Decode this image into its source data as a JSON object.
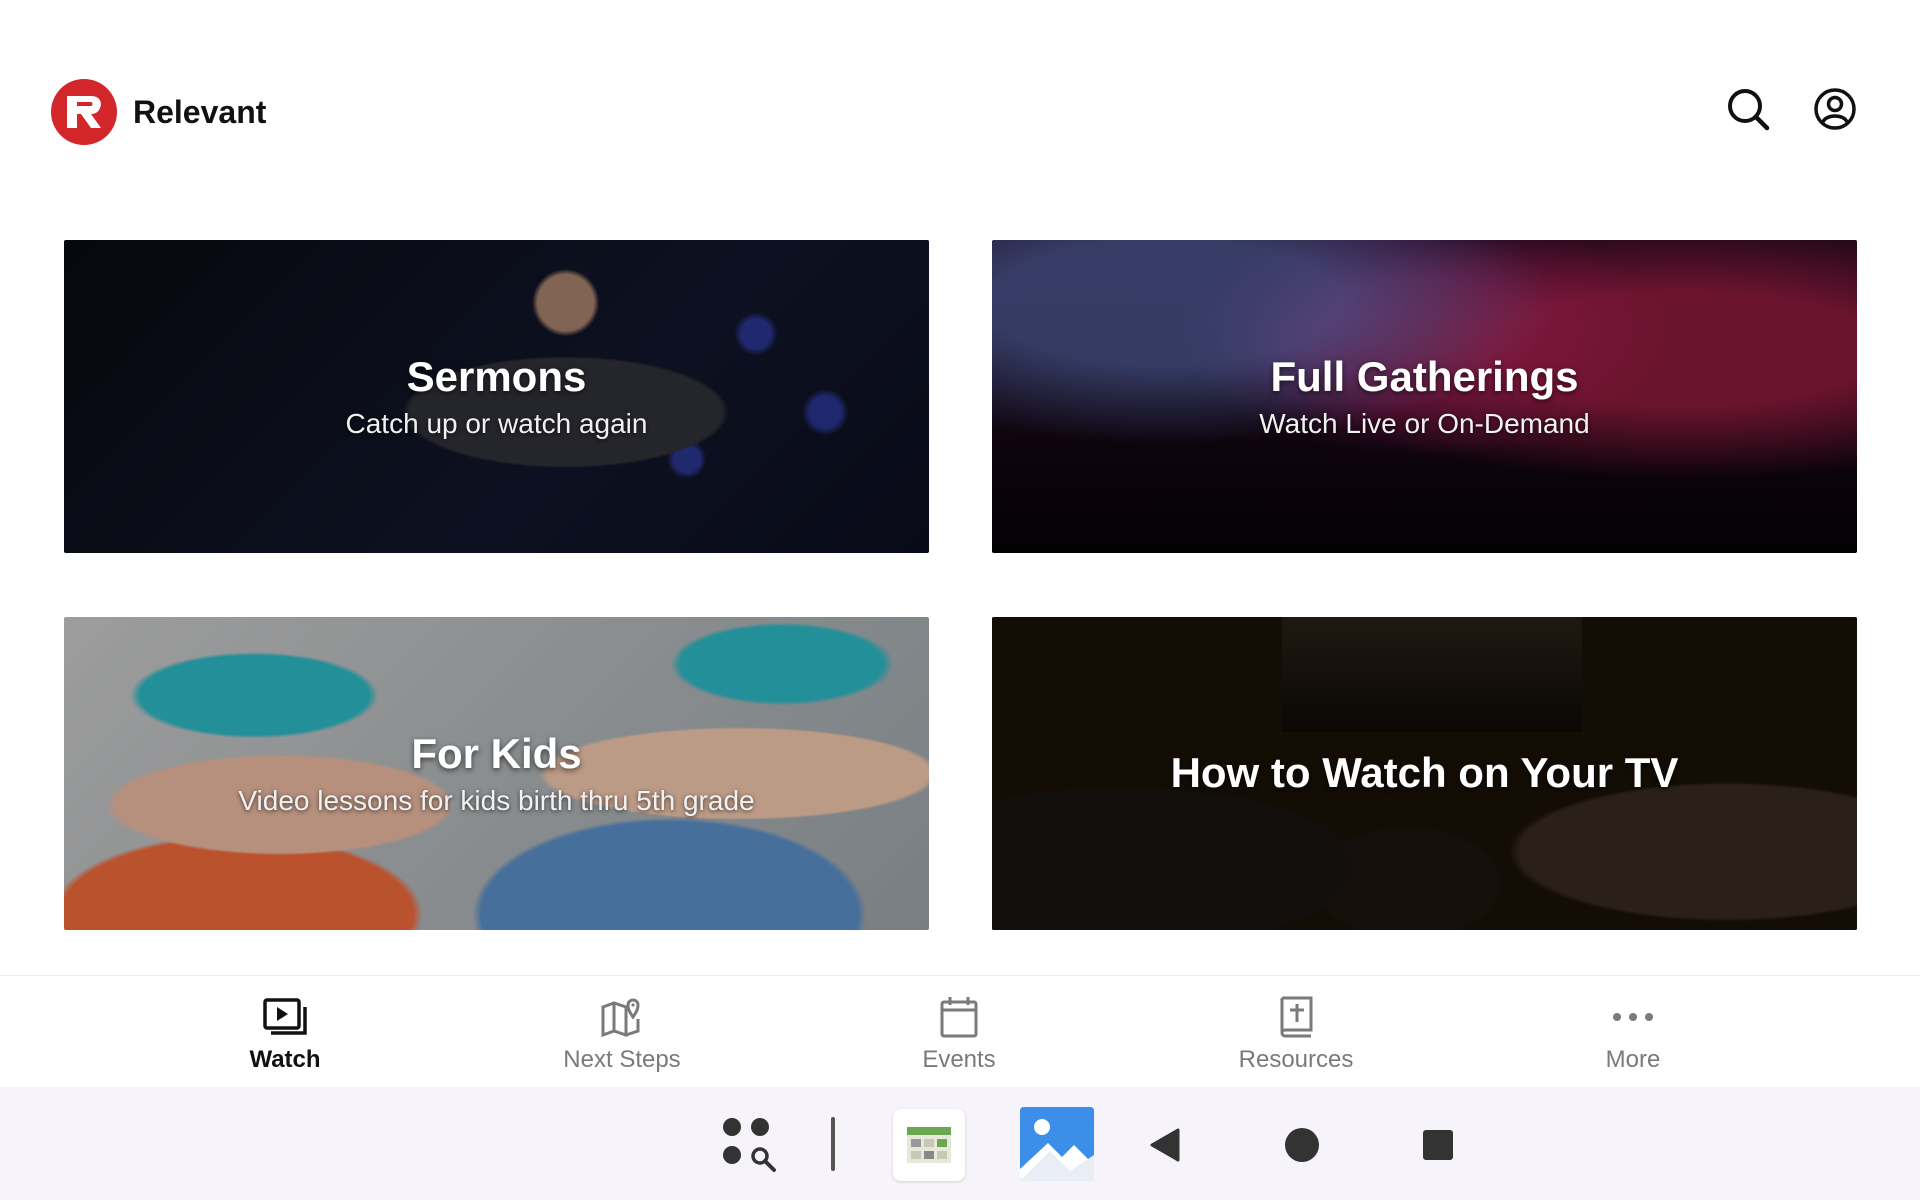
{
  "header": {
    "brand_name": "Relevant"
  },
  "cards": [
    {
      "title": "Sermons",
      "subtitle": "Catch up or watch again"
    },
    {
      "title": "Full Gatherings",
      "subtitle": "Watch Live or On-Demand"
    },
    {
      "title": "For Kids",
      "subtitle": "Video lessons for kids birth thru 5th grade"
    },
    {
      "title": "How to Watch on Your TV",
      "subtitle": ""
    }
  ],
  "bottom_nav": {
    "items": [
      {
        "label": "Watch",
        "icon": "video-library-icon",
        "active": true
      },
      {
        "label": "Next Steps",
        "icon": "map-pin-icon",
        "active": false
      },
      {
        "label": "Events",
        "icon": "calendar-icon",
        "active": false
      },
      {
        "label": "Resources",
        "icon": "bible-icon",
        "active": false
      },
      {
        "label": "More",
        "icon": "more-dots-icon",
        "active": false
      }
    ]
  },
  "colors": {
    "brand": "#d3262b",
    "active_nav": "#111111",
    "inactive_nav": "#7a7a7a"
  }
}
